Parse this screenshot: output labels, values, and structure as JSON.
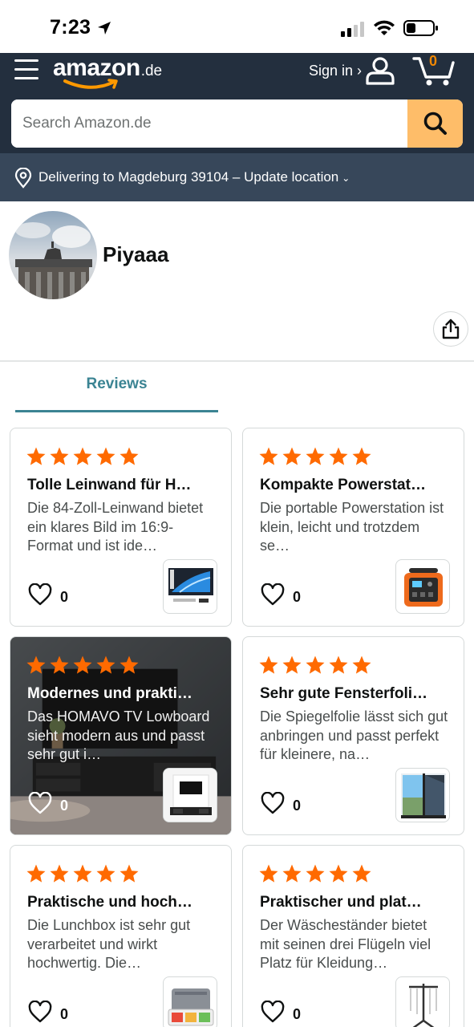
{
  "status_bar": {
    "time": "7:23"
  },
  "header": {
    "logo": {
      "brand": "amazon",
      "tld": ".de"
    },
    "sign_in_label": "Sign in ›",
    "cart_count": "0",
    "search_placeholder": "Search Amazon.de",
    "delivery_text": "Delivering to Magdeburg 39104 – Update location",
    "colors": {
      "nav": "#232f3e",
      "subnav": "#37475a",
      "search_button": "#febd69",
      "cart_count": "#f08804"
    }
  },
  "profile": {
    "name": "Piyaaa"
  },
  "tabs": [
    {
      "label": "Reviews",
      "active": true
    }
  ],
  "reviews": [
    {
      "rating": 5,
      "title": "Tolle Leinwand für H…",
      "excerpt": "Die 84-Zoll-Leinwand bietet ein klares Bild im 16:9-Format und ist ide…",
      "likes": "0",
      "thumbnail": "projector-screen"
    },
    {
      "rating": 5,
      "title": "Kompakte Powerstat…",
      "excerpt": "Die portable Powerstation ist klein, leicht und trotzdem se…",
      "likes": "0",
      "thumbnail": "power-station"
    },
    {
      "rating": 5,
      "title": "Modernes und prakti…",
      "excerpt": "Das HOMAVO TV Lowboard sieht modern aus und passt sehr gut i…",
      "likes": "0",
      "thumbnail": "tv-lowboard"
    },
    {
      "rating": 5,
      "title": "Sehr gute Fensterfoli…",
      "excerpt": "Die Spiegelfolie lässt sich gut anbringen und passt perfekt für kleinere, na…",
      "likes": "0",
      "thumbnail": "window-film"
    },
    {
      "rating": 5,
      "title": "Praktische und hoch…",
      "excerpt": "Die Lunchbox ist sehr gut verarbeitet und wirkt hochwertig. Die…",
      "likes": "0",
      "thumbnail": "lunchbox"
    },
    {
      "rating": 5,
      "title": "Praktischer und plat…",
      "excerpt": "Der Wäscheständer bietet mit seinen drei Flügeln viel Platz für Kleidung…",
      "likes": "0",
      "thumbnail": "drying-rack"
    }
  ],
  "star_color": "#ff6a00"
}
